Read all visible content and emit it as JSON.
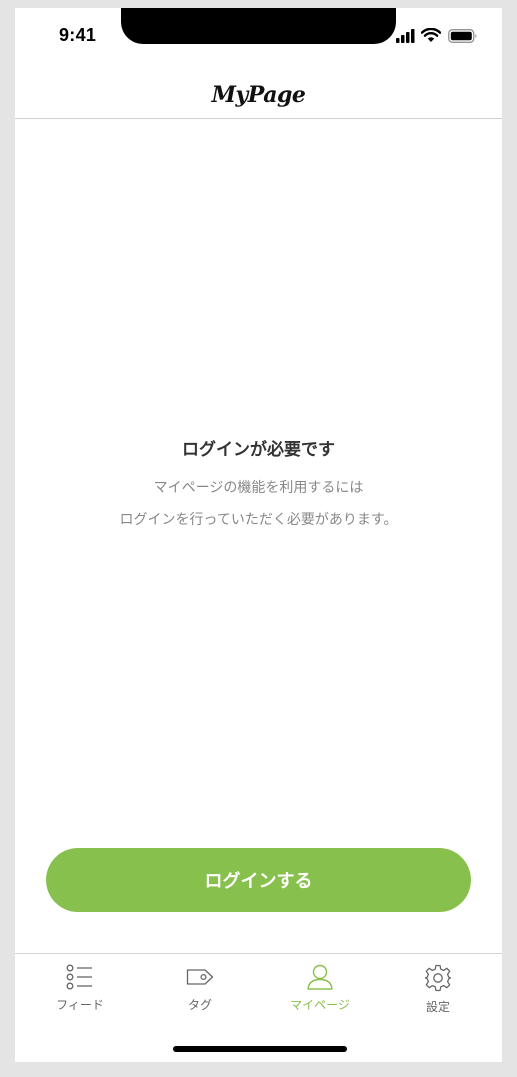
{
  "status_bar": {
    "time": "9:41"
  },
  "header": {
    "title": "MyPage"
  },
  "empty_state": {
    "title": "ログインが必要です",
    "line1": "マイページの機能を利用するには",
    "line2": "ログインを行っていただく必要があります。"
  },
  "login_button": {
    "label": "ログインする"
  },
  "tab_bar": {
    "tabs": [
      {
        "label": "フィード",
        "icon": "list-icon",
        "active": false
      },
      {
        "label": "タグ",
        "icon": "tag-icon",
        "active": false
      },
      {
        "label": "マイページ",
        "icon": "person-icon",
        "active": true
      },
      {
        "label": "設定",
        "icon": "gear-icon",
        "active": false
      }
    ]
  },
  "colors": {
    "accent": "#88c04d",
    "inactive": "#666666",
    "divider": "#d6d6d6"
  }
}
